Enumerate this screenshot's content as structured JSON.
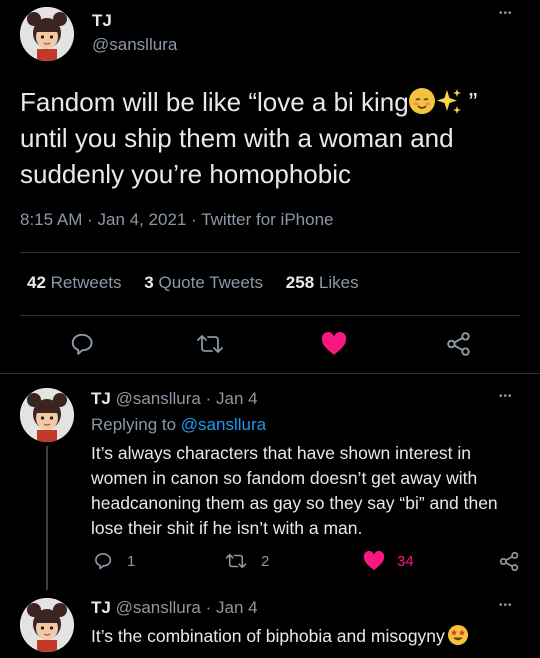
{
  "main_tweet": {
    "display_name": "TJ",
    "handle": "@sansllura",
    "more_label": "•••",
    "text_line1": "Fandom will be like “love a bi king",
    "text_line1_emoji1": "😊",
    "text_line1_emoji2": "✨",
    "text_line1_end": "”",
    "text_line2": "until you ship them with a woman and",
    "text_line3": "suddenly you’re homophobic",
    "time": "8:15 AM",
    "sep1": "·",
    "date": "Jan 4, 2021",
    "sep2": "·",
    "source": "Twitter for iPhone",
    "stats": {
      "retweets_count": "42",
      "retweets_label": "Retweets",
      "quotes_count": "3",
      "quotes_label": "Quote Tweets",
      "likes_count": "258",
      "likes_label": "Likes"
    }
  },
  "reply1": {
    "display_name": "TJ",
    "handle": "@sansllura",
    "sep": "·",
    "date": "Jan 4",
    "more_label": "•••",
    "replying_to_label": "Replying to",
    "replying_to_handle": "@sansllura",
    "line1": "It’s always characters that have shown interest in",
    "line2": "women in canon so fandom doesn’t get away with",
    "line3": "headcanoning them as gay so they say “bi” and then",
    "line4": "lose their shit if he isn’t with a man.",
    "reply_count": "1",
    "retweet_count": "2",
    "like_count": "34"
  },
  "reply2": {
    "display_name": "TJ",
    "handle": "@sansllura",
    "sep": "·",
    "date": "Jan 4",
    "more_label": "•••",
    "line1": "It’s the combination of biphobia and misogyny",
    "emoji": "🤩"
  },
  "colors": {
    "background": "#000000",
    "text": "#e7e9ea",
    "muted": "#8b98a5",
    "accent": "#1d9bf0",
    "like": "#f91880",
    "divider": "#2f3336"
  },
  "icons": {
    "reply": "reply-icon",
    "retweet": "retweet-icon",
    "like": "heart-icon",
    "share": "share-icon"
  }
}
